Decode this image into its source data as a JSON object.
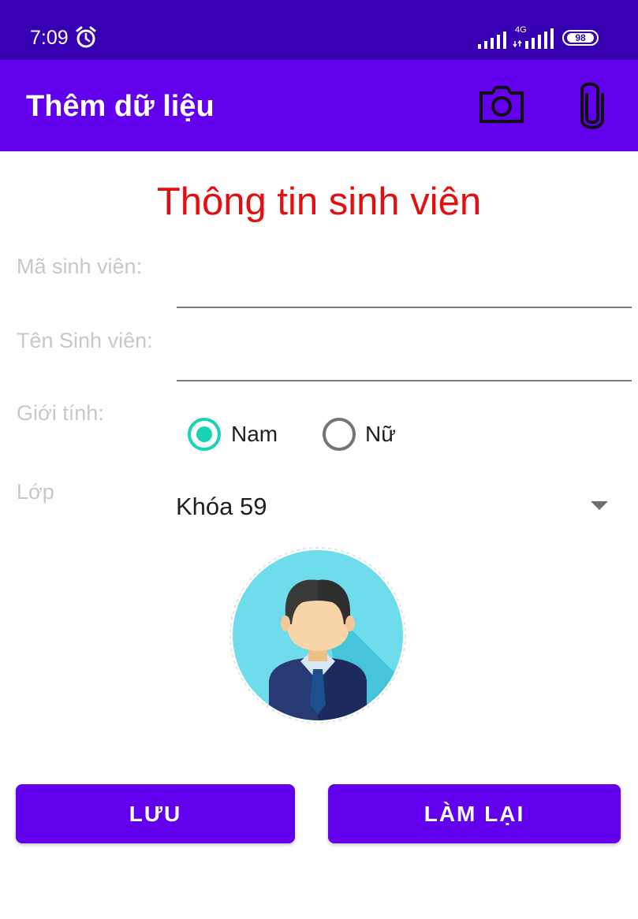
{
  "status_bar": {
    "time": "7:09",
    "network": "4G",
    "battery": "98"
  },
  "app_bar": {
    "title": "Thêm dữ liệu"
  },
  "form": {
    "heading": "Thông tin sinh viên",
    "student_id_label": "Mã sinh viên:",
    "student_name_label": "Tên Sinh viên:",
    "gender_label": "Giới tính:",
    "gender_options": [
      "Nam",
      "Nữ"
    ],
    "selected_gender": "Nam",
    "class_label": "Lớp",
    "class_value": "Khóa 59"
  },
  "buttons": {
    "save": "LƯU",
    "reset": "LÀM LẠI"
  },
  "icons": [
    "alarm-icon",
    "camera-icon",
    "paperclip-icon",
    "dropdown-arrow-icon",
    "avatar-image"
  ],
  "colors": {
    "status_bar": "#3700b3",
    "app_bar": "#6200ee",
    "heading": "#e10f0f",
    "radio_checked": "#19d4b4"
  }
}
